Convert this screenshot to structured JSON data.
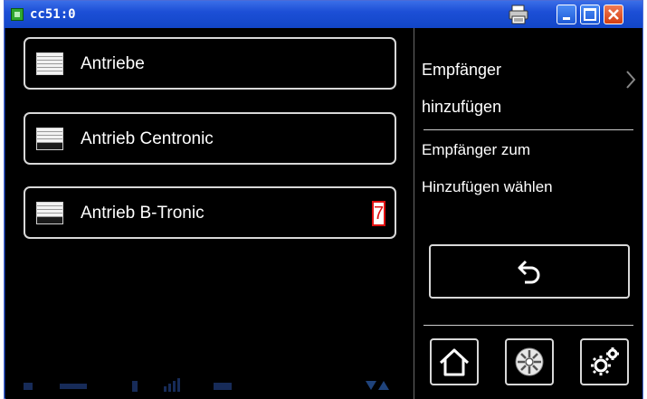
{
  "window": {
    "title": "cc51:0",
    "icons": {
      "app": "app-icon",
      "print": "printer-icon",
      "minimize": "minimize-icon",
      "maximize": "maximize-icon",
      "close": "close-icon"
    }
  },
  "list": {
    "items": [
      {
        "label": "Antriebe",
        "icon": "shutter-icon"
      },
      {
        "label": "Antrieb Centronic",
        "icon": "shutter-half-icon"
      },
      {
        "label": "Antrieb B-Tronic",
        "icon": "shutter-half-icon",
        "badge": "7"
      }
    ]
  },
  "panel": {
    "title_line1": "Empfänger",
    "title_line2": "hinzufügen",
    "hint_line1": "Empfänger zum",
    "hint_line2": "Hinzufügen wählen",
    "back_icon": "back-arrow-icon",
    "nav_icons": [
      "home-icon",
      "sun-icon",
      "settings-icon"
    ]
  },
  "colors": {
    "titlebar": "#1c4fd6",
    "screen_bg": "#000000",
    "button_border": "#d8d8d8",
    "badge": "#e01010"
  }
}
